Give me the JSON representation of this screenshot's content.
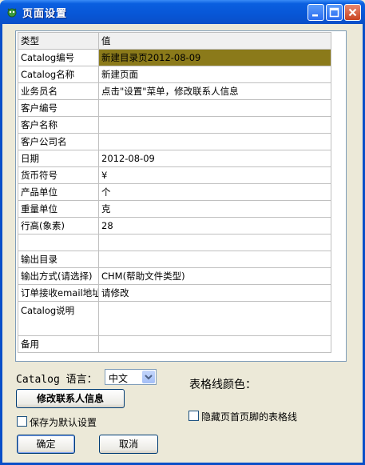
{
  "window": {
    "title": "页面设置"
  },
  "table": {
    "header": {
      "name": "类型",
      "value": "值"
    },
    "rows": [
      {
        "name": "Catalog编号",
        "value": "新建目录页2012-08-09"
      },
      {
        "name": "Catalog名称",
        "value": "新建页面"
      },
      {
        "name": "业务员名",
        "value": "点击\"设置\"菜单，修改联系人信息"
      },
      {
        "name": "客户编号",
        "value": ""
      },
      {
        "name": "客户名称",
        "value": ""
      },
      {
        "name": "客户公司名",
        "value": ""
      },
      {
        "name": "日期",
        "value": "2012-08-09"
      },
      {
        "name": "货币符号",
        "value": "¥"
      },
      {
        "name": "产品单位",
        "value": "个"
      },
      {
        "name": "重量单位",
        "value": "克"
      },
      {
        "name": "行高(象素)",
        "value": "28"
      },
      {
        "name": "",
        "value": ""
      },
      {
        "name": "输出目录",
        "value": ""
      },
      {
        "name": "输出方式(请选择)",
        "value": "CHM(帮助文件类型)"
      },
      {
        "name": "订单接收email地址",
        "value": "请修改"
      },
      {
        "name": "Catalog说明",
        "value": ""
      },
      {
        "name": "备用",
        "value": ""
      }
    ]
  },
  "language": {
    "label": "Catalog 语言：",
    "selected": "中文"
  },
  "buttons": {
    "edit_contact": "修改联系人信息",
    "ok": "确定",
    "cancel": "取消"
  },
  "checkboxes": {
    "save_default": "保存为默认设置",
    "hide_header_footer_lines": "隐藏页首页脚的表格线"
  },
  "grid_color_label": "表格线颜色："
}
